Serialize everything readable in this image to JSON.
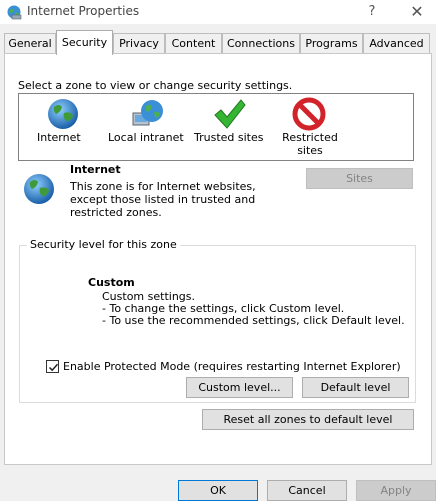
{
  "window": {
    "title": "Internet Properties",
    "help_label": "?",
    "close_label": "✕"
  },
  "tabs": [
    {
      "label": "General"
    },
    {
      "label": "Security",
      "active": true
    },
    {
      "label": "Privacy"
    },
    {
      "label": "Content"
    },
    {
      "label": "Connections"
    },
    {
      "label": "Programs"
    },
    {
      "label": "Advanced"
    }
  ],
  "security": {
    "select_label": "Select a zone to view or change security settings.",
    "zones": [
      {
        "label": "Internet",
        "icon": "globe-icon"
      },
      {
        "label": "Local intranet",
        "icon": "intranet-icon"
      },
      {
        "label": "Trusted sites",
        "icon": "checkmark-icon"
      },
      {
        "label": "Restricted sites",
        "icon": "restricted-icon"
      }
    ],
    "zone_info": {
      "name": "Internet",
      "description": "This zone is for Internet websites, except those listed in trusted and restricted zones."
    },
    "sites_button": "Sites",
    "level_legend": "Security level for this zone",
    "level_name": "Custom",
    "level_desc_1": "Custom settings.",
    "level_desc_2": "- To change the settings, click Custom level.",
    "level_desc_3": "- To use the recommended settings, click Default level.",
    "protected_mode_label": "Enable Protected Mode (requires restarting Internet Explorer)",
    "protected_mode_checked": true,
    "custom_level_button": "Custom level...",
    "default_level_button": "Default level",
    "reset_button": "Reset all zones to default level"
  },
  "footer": {
    "ok": "OK",
    "cancel": "Cancel",
    "apply": "Apply"
  },
  "colors": {
    "focus_border": "#0078d7",
    "disabled_text": "#838383"
  }
}
